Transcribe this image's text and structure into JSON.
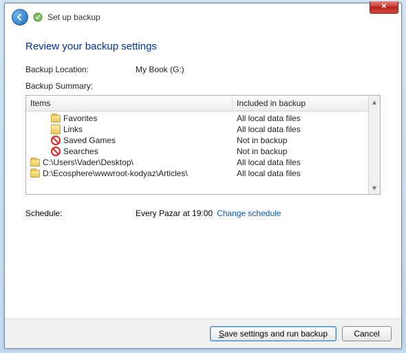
{
  "header": {
    "title": "Set up backup"
  },
  "heading": "Review your backup settings",
  "location": {
    "label": "Backup Location:",
    "value": "My Book (G:)"
  },
  "summary_label": "Backup Summary:",
  "columns": {
    "items": "Items",
    "included": "Included in backup"
  },
  "items": [
    {
      "icon": "folder",
      "indent": true,
      "name": "Favorites",
      "included": "All local data files"
    },
    {
      "icon": "link",
      "indent": true,
      "name": "Links",
      "included": "All local data files"
    },
    {
      "icon": "no",
      "indent": true,
      "name": "Saved Games",
      "included": "Not in backup"
    },
    {
      "icon": "no",
      "indent": true,
      "name": "Searches",
      "included": "Not in backup"
    },
    {
      "icon": "folder",
      "indent": false,
      "name": "C:\\Users\\Vader\\Desktop\\",
      "included": "All local data files"
    },
    {
      "icon": "folder",
      "indent": false,
      "name": "D:\\Ecosphere\\wwwroot-kodyaz\\Articles\\",
      "included": "All local data files"
    }
  ],
  "schedule": {
    "label": "Schedule:",
    "value": "Every Pazar at 19:00",
    "link": "Change schedule"
  },
  "buttons": {
    "save_prefix": "S",
    "save_rest": "ave settings and run backup",
    "cancel": "Cancel"
  }
}
